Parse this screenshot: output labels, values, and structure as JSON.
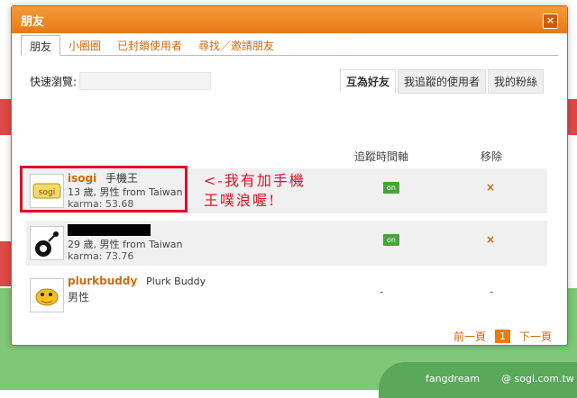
{
  "dialog": {
    "title": "朋友",
    "close_glyph": "×"
  },
  "tabs": [
    "朋友",
    "小圈圈",
    "已封鎖使用者",
    "尋找／邀請朋友"
  ],
  "filter": {
    "label": "快速瀏覽:"
  },
  "subtabs": [
    "互為好友",
    "我追蹤的使用者",
    "我的粉絲"
  ],
  "columns": {
    "timeline": "追蹤時間軸",
    "remove": "移除"
  },
  "friends": [
    {
      "nick": "isogi",
      "display": "手機王",
      "info": "13 歲, 男性 from Taiwan",
      "karma": "karma: 53.68",
      "timeline": "on",
      "remove": "×"
    },
    {
      "nick": "",
      "display": "",
      "info": "29 歲, 男性 from Taiwan",
      "karma": "karma: 73.76",
      "timeline": "on",
      "remove": "×"
    },
    {
      "nick": "plurkbuddy",
      "display": "Plurk Buddy",
      "info": "男性",
      "karma": "",
      "timeline": "-",
      "remove": "-"
    }
  ],
  "annotation": {
    "line1": "<-我有加手機",
    "line2": "王噗浪喔!"
  },
  "pager": {
    "prev": "前一頁",
    "current": "1",
    "next": "下一頁"
  },
  "credits": {
    "left": "fangdream",
    "right": "@ sogi.com.tw"
  }
}
